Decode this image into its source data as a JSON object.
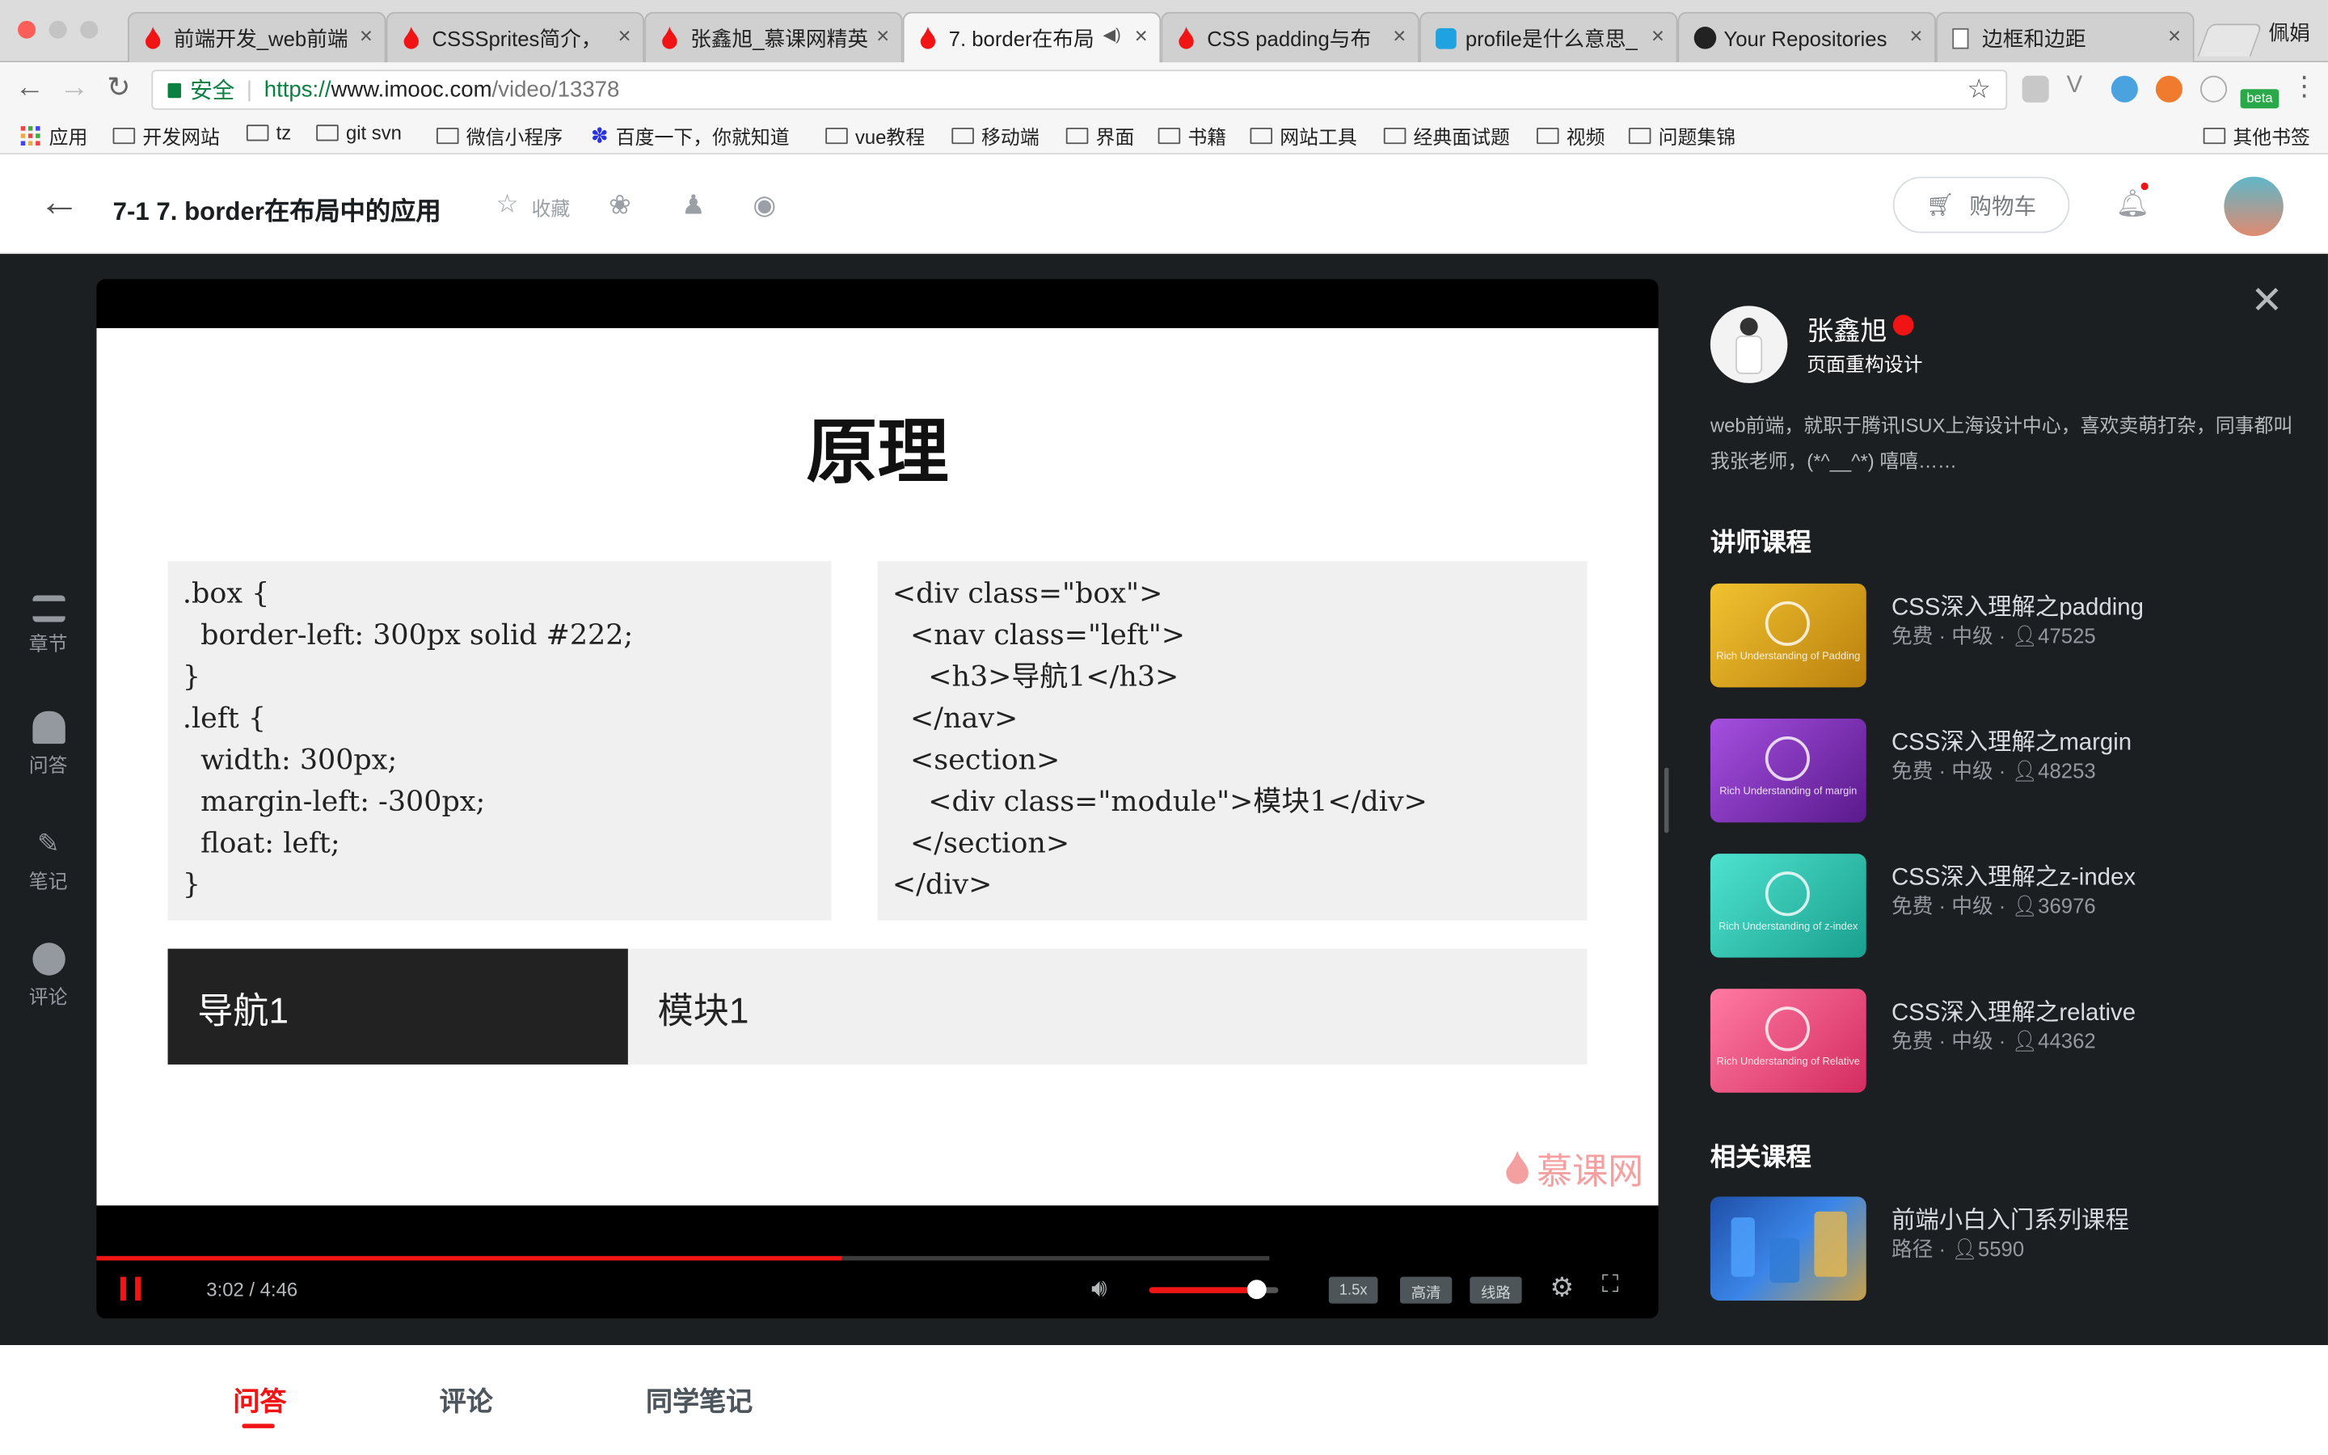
{
  "browser": {
    "tabs": [
      {
        "title": "前端开发_web前端",
        "active": false
      },
      {
        "title": "CSSSprites简介，",
        "active": false
      },
      {
        "title": "张鑫旭_慕课网精英",
        "active": false
      },
      {
        "title": "7. border在布局",
        "active": true,
        "muted_audio_icon": "speaker-icon"
      },
      {
        "title": "CSS padding与布",
        "active": false
      },
      {
        "title": "profile是什么意思_",
        "active": false
      },
      {
        "title": "Your Repositories",
        "active": false
      },
      {
        "title": "边框和边距",
        "active": false
      }
    ],
    "profile_name": "佩娟",
    "secure_label": "安全",
    "url_scheme": "https://",
    "url_host": "www.imooc.com",
    "url_path": "/video/13378",
    "bookmarks": [
      "应用",
      "开发网站",
      "tz",
      "git svn",
      "微信小程序",
      "百度一下，你就知道",
      "vue教程",
      "移动端",
      "界面",
      "书籍",
      "网站工具",
      "经典面试题",
      "视频",
      "问题集锦"
    ],
    "other_bookmarks": "其他书签",
    "beta_label": "beta"
  },
  "header": {
    "lesson_title": "7-1 7. border在布局中的应用",
    "favorite_label": "收藏",
    "cart_label": "购物车"
  },
  "left_nav": [
    {
      "label": "章节",
      "icon": "list-icon"
    },
    {
      "label": "问答",
      "icon": "qa-icon"
    },
    {
      "label": "笔记",
      "icon": "pencil-icon"
    },
    {
      "label": "评论",
      "icon": "comment-icon"
    }
  ],
  "slide": {
    "title": "原理",
    "css_code": ".box {\n  border-left: 300px solid #222;\n}\n.left {\n  width: 300px;\n  margin-left: -300px;\n  float: left;\n}",
    "html_code": "<div class=\"box\">\n  <nav class=\"left\">\n    <h3>导航1</h3>\n  </nav>\n  <section>\n    <div class=\"module\">模块1</div>\n  </section>\n</div>",
    "demo_nav": "导航1",
    "demo_module": "模块1",
    "watermark": "慕课网"
  },
  "player": {
    "time": "3:02 / 4:46",
    "progress_fraction": 0.635,
    "volume_fraction": 0.83,
    "speed": "1.5x",
    "quality": "高清",
    "route": "线路"
  },
  "teacher": {
    "name": "张鑫旭",
    "role": "页面重构设计",
    "bio": "web前端，就职于腾讯ISUX上海设计中心，喜欢卖萌打杂，同事都叫我张老师，(*^__^*) 嘻嘻……"
  },
  "teacher_courses_title": "讲师课程",
  "teacher_courses": [
    {
      "title": "CSS深入理解之padding",
      "meta": "免费 · 中级 · ",
      "students": "47525",
      "cover_caption": "Rich Understanding of Padding",
      "color": "#d9a21a"
    },
    {
      "title": "CSS深入理解之margin",
      "meta": "免费 · 中级 · ",
      "students": "48253",
      "cover_caption": "Rich Understanding of margin",
      "color": "#7d2fb0"
    },
    {
      "title": "CSS深入理解之z-index",
      "meta": "免费 · 中级 · ",
      "students": "36976",
      "cover_caption": "Rich Understanding of z-index",
      "color": "#2fc9b6"
    },
    {
      "title": "CSS深入理解之relative",
      "meta": "免费 · 中级 · ",
      "students": "44362",
      "cover_caption": "Rich Understanding of Relative",
      "color": "#e8457a"
    }
  ],
  "related_title": "相关课程",
  "related_courses": [
    {
      "title": "前端小白入门系列课程",
      "meta": "路径 · ",
      "students": "5590",
      "color": "#2f6fd1"
    }
  ],
  "bottom_tabs": [
    "问答",
    "评论",
    "同学笔记"
  ]
}
